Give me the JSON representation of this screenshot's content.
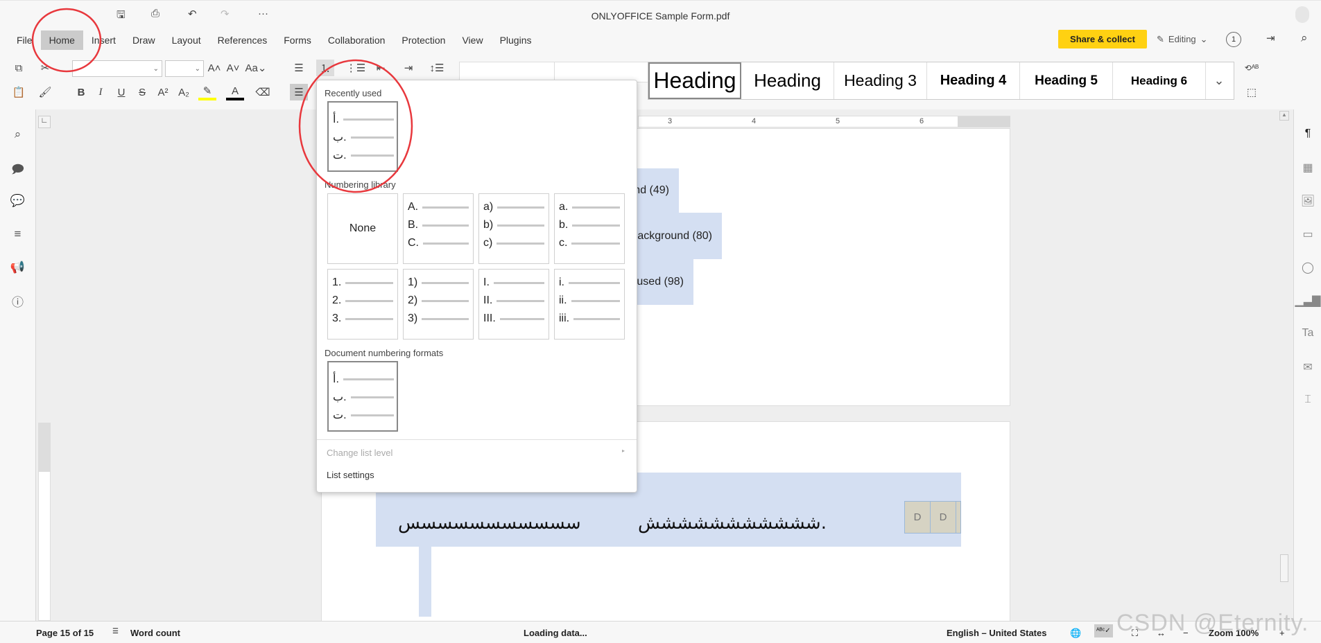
{
  "window": {
    "title": "ONLYOFFICE Sample Form.pdf"
  },
  "quick_access": [
    {
      "icon": "save-icon",
      "glyph": "💾"
    },
    {
      "icon": "print-icon",
      "glyph": "⎙"
    },
    {
      "icon": "undo-icon",
      "glyph": "↶"
    },
    {
      "icon": "redo-icon",
      "glyph": "↷"
    },
    {
      "icon": "more-icon",
      "glyph": "···"
    }
  ],
  "menu": {
    "tabs": [
      "File",
      "Home",
      "Insert",
      "Draw",
      "Layout",
      "References",
      "Forms",
      "Collaboration",
      "Protection",
      "View",
      "Plugins"
    ],
    "active": "Home"
  },
  "header": {
    "share_label": "Share & collect",
    "mode_label": "Editing",
    "users_count": "1",
    "accent": "#ffd112"
  },
  "toolbar": {
    "font_name": "",
    "font_size": "",
    "styles": [
      "Heading",
      "Heading",
      "Heading 3",
      "Heading 4",
      "Heading 5",
      "Heading 6"
    ]
  },
  "numbering_menu": {
    "recent_label": "Recently used",
    "recent": [
      "أ.",
      "ب.",
      "ت."
    ],
    "library_label": "Numbering library",
    "none_label": "None",
    "library": [
      [
        "A.",
        "B.",
        "C."
      ],
      [
        "a)",
        "b)",
        "c)"
      ],
      [
        "a.",
        "b.",
        "c."
      ],
      [
        "1.",
        "2.",
        "3."
      ],
      [
        "1)",
        "2)",
        "3)"
      ],
      [
        "I.",
        "II.",
        "III."
      ],
      [
        "i.",
        "ii.",
        "iii."
      ]
    ],
    "doc_label": "Document numbering formats",
    "doc": [
      "أ.",
      "ب.",
      "ت."
    ],
    "change_level": "Change list level",
    "list_settings": "List settings"
  },
  "ruler": {
    "labels": [
      "3",
      "4",
      "5",
      "6"
    ]
  },
  "document": {
    "page1_items": [
      "nd (49)",
      "ackground (80)",
      "used (98)"
    ],
    "page2_text_a": "سسسسسسسسسسس",
    "page2_text_b": "ششششششششششش.",
    "field_cells": [
      "D",
      "D"
    ],
    "highlight": "#d4dff2"
  },
  "status": {
    "page": "Page 15 of 15",
    "word_count": "Word count",
    "loading": "Loading data...",
    "language": "English – United States",
    "zoom": "Zoom 100%"
  },
  "watermark": "CSDN @Eternity."
}
